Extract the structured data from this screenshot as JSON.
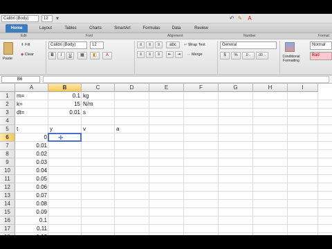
{
  "toolbar": {
    "font_name": "Calibri (Body)",
    "font_size": "12"
  },
  "tabs": [
    "Home",
    "Layout",
    "Tables",
    "Charts",
    "SmartArt",
    "Formulas",
    "Data",
    "Review"
  ],
  "active_tab": "Home",
  "groups": {
    "edit": "Edit",
    "font": "Font",
    "alignment": "Alignment",
    "number": "Number",
    "format": "Format"
  },
  "ribbon": {
    "paste": "Paste",
    "fill": "Fill",
    "clear": "Clear",
    "font_name": "Calibri (Body)",
    "font_size": "12",
    "abc": "abc",
    "wrap_text": "Wrap Text",
    "merge": "Merge",
    "number_format": "General",
    "conditional_formatting": "Conditional Formatting",
    "style_normal": "Normal",
    "style_bad": "Bad"
  },
  "formula_bar": {
    "name_box": "B6"
  },
  "columns": [
    "A",
    "B",
    "C",
    "D",
    "E",
    "F",
    "G",
    "H",
    "I"
  ],
  "selected_column": "B",
  "rows": [
    {
      "n": "1",
      "A": "m=",
      "B": "0.1",
      "C": "kg",
      "D": ""
    },
    {
      "n": "2",
      "A": "k=",
      "B": "15",
      "C": "N/m",
      "D": ""
    },
    {
      "n": "3",
      "A": "dt=",
      "B": "0.01",
      "C": "s",
      "D": ""
    },
    {
      "n": "4",
      "A": "",
      "B": "",
      "C": "",
      "D": ""
    },
    {
      "n": "5",
      "A": "t",
      "B": "y",
      "C": "v",
      "D": "a"
    },
    {
      "n": "6",
      "A": "0",
      "B": "",
      "C": "",
      "D": ""
    },
    {
      "n": "7",
      "A": "0.01",
      "B": "",
      "C": "",
      "D": ""
    },
    {
      "n": "8",
      "A": "0.02",
      "B": "",
      "C": "",
      "D": ""
    },
    {
      "n": "9",
      "A": "0.03",
      "B": "",
      "C": "",
      "D": ""
    },
    {
      "n": "10",
      "A": "0.04",
      "B": "",
      "C": "",
      "D": ""
    },
    {
      "n": "11",
      "A": "0.05",
      "B": "",
      "C": "",
      "D": ""
    },
    {
      "n": "12",
      "A": "0.06",
      "B": "",
      "C": "",
      "D": ""
    },
    {
      "n": "13",
      "A": "0.07",
      "B": "",
      "C": "",
      "D": ""
    },
    {
      "n": "14",
      "A": "0.08",
      "B": "",
      "C": "",
      "D": ""
    },
    {
      "n": "15",
      "A": "0.09",
      "B": "",
      "C": "",
      "D": ""
    },
    {
      "n": "16",
      "A": "0.1",
      "B": "",
      "C": "",
      "D": ""
    },
    {
      "n": "17",
      "A": "0.11",
      "B": "",
      "C": "",
      "D": ""
    },
    {
      "n": "18",
      "A": "0.12",
      "B": "",
      "C": "",
      "D": ""
    }
  ],
  "selected_row": "6",
  "active_cell": "B6",
  "colors": {
    "tab_active": "#3e7cc2",
    "selection_border": "#4a6ec9",
    "header_selected": "#f1c85a",
    "style_bad": "#ffc7ce"
  }
}
